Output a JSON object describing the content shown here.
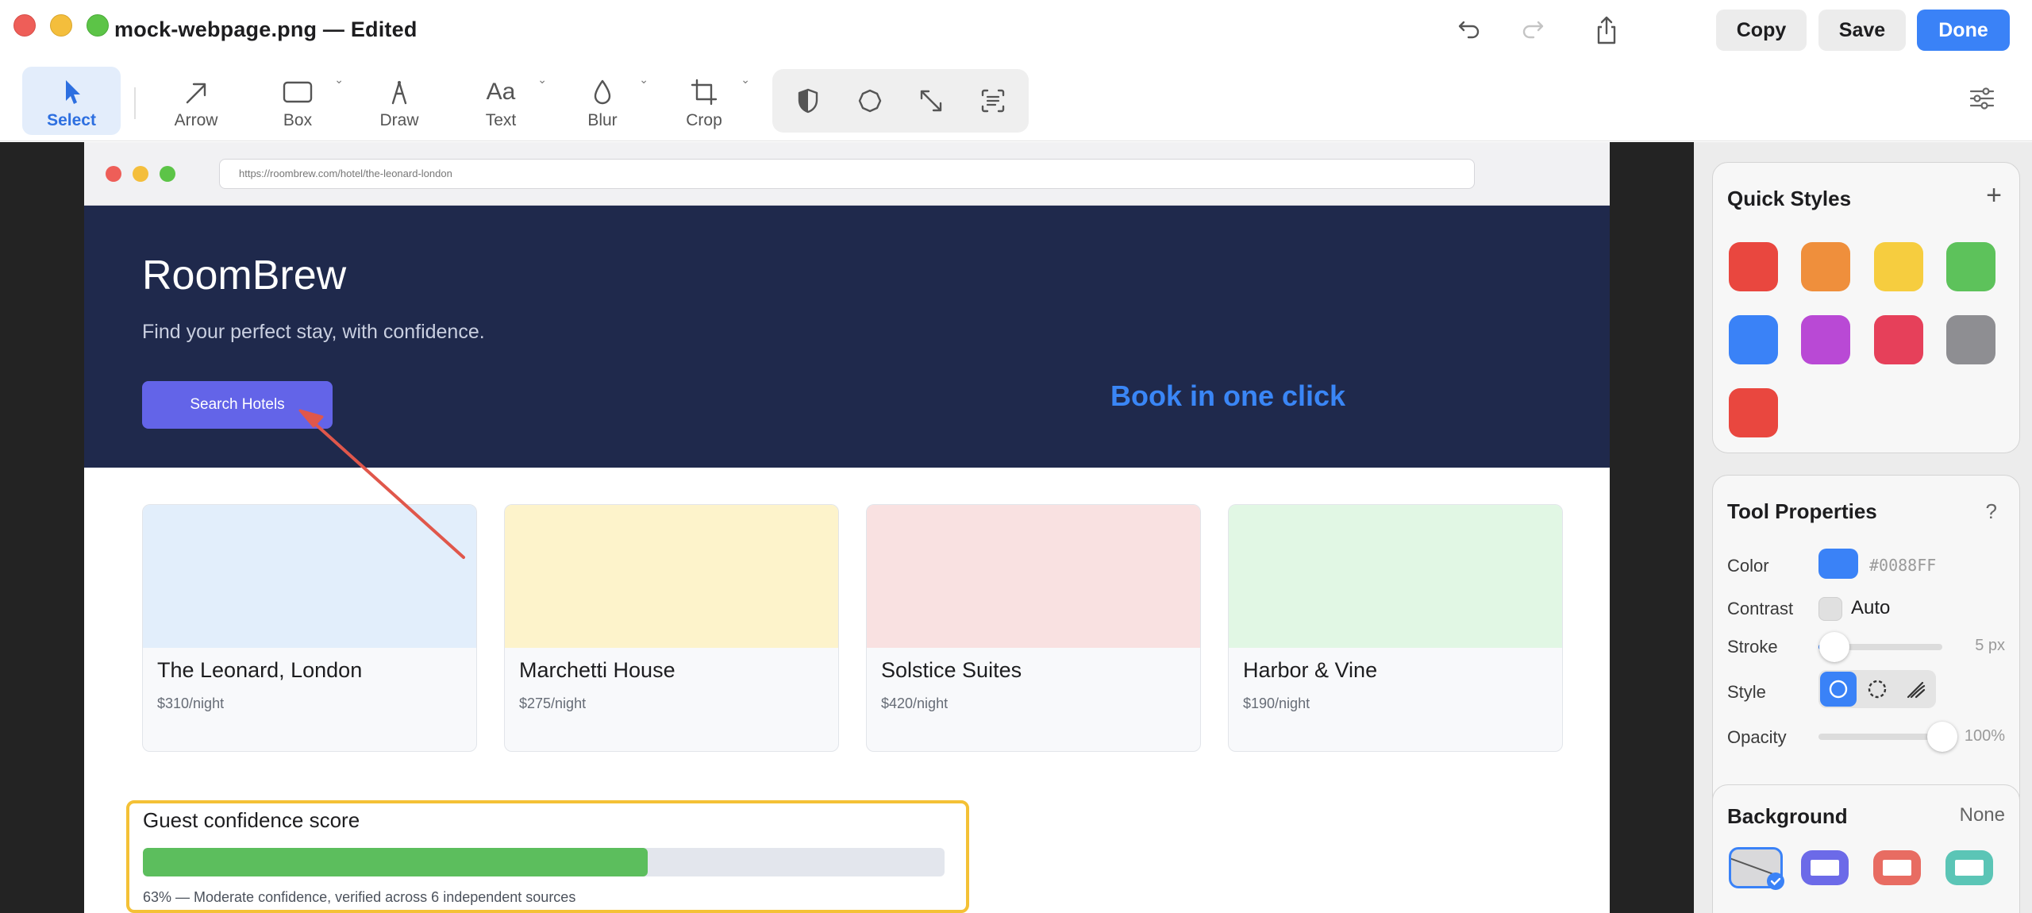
{
  "window": {
    "title": "mock-webpage.png — Edited",
    "buttons": {
      "copy": "Copy",
      "save": "Save",
      "done": "Done"
    }
  },
  "toolbar": {
    "tools": [
      {
        "label": "Select",
        "icon": "pointer-icon",
        "active": true
      },
      {
        "label": "Arrow",
        "icon": "arrow-icon"
      },
      {
        "label": "Box",
        "icon": "box-icon"
      },
      {
        "label": "Draw",
        "icon": "pen-icon"
      },
      {
        "label": "Text",
        "icon": "text-icon",
        "glyph": "Aa"
      },
      {
        "label": "Blur",
        "icon": "blur-drop-icon"
      },
      {
        "label": "Crop",
        "icon": "crop-icon"
      }
    ],
    "group_icons": [
      "shield-icon",
      "polygon-icon",
      "resize-icon",
      "text-recognition-icon"
    ]
  },
  "webpage": {
    "url": "https://roombrew.com/hotel/the-leonard-london",
    "brand": "RoomBrew",
    "tagline": "Find your perfect stay, with confidence.",
    "search_button": "Search Hotels",
    "promo": "Book in one click",
    "hotels": [
      {
        "name": "The Leonard, London",
        "price": "$310/night",
        "color": "#e2eefb"
      },
      {
        "name": "Marchetti House",
        "price": "$275/night",
        "color": "#fdf3cb"
      },
      {
        "name": "Solstice Suites",
        "price": "$420/night",
        "color": "#f9e1e1"
      },
      {
        "name": "Harbor & Vine",
        "price": "$190/night",
        "color": "#e1f7e4"
      }
    ],
    "score": {
      "title": "Guest confidence score",
      "percent": 63,
      "note": "63% — Moderate confidence, verified across 6 independent sources"
    }
  },
  "panel": {
    "quick_styles": {
      "title": "Quick Styles",
      "colors": [
        "#e9473f",
        "#ef8f3c",
        "#f6cd3f",
        "#5dc25b",
        "#3a82f7",
        "#b949d5",
        "#e6405a",
        "#8e8e92",
        "#e9473f"
      ]
    },
    "tool_properties": {
      "title": "Tool Properties",
      "help": "?",
      "color_label": "Color",
      "color_value": "#0088FF",
      "color_swatch": "#3a82f7",
      "contrast_label": "Contrast",
      "contrast_value": "Auto",
      "stroke_label": "Stroke",
      "stroke_value": "5 px",
      "stroke_level": 0.13,
      "style_label": "Style",
      "opacity_label": "Opacity",
      "opacity_value": "100%",
      "opacity_level": 1.0
    },
    "background": {
      "title": "Background",
      "value": "None",
      "swatches": [
        "#d9d9db",
        "#6c6ae8",
        "#e86c62",
        "#5bc5b6"
      ]
    }
  }
}
